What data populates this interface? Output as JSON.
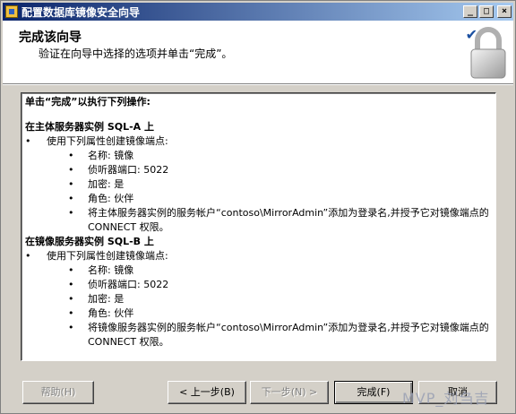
{
  "window": {
    "title": "配置数据库镜像安全向导"
  },
  "header": {
    "title": "完成该向导",
    "subtitle": "验证在向导中选择的选项并单击“完成”。"
  },
  "content": {
    "intro": "单击“完成”以执行下列操作:",
    "sections": [
      {
        "heading": "在主体服务器实例 SQL-A 上",
        "item": "使用下列属性创建镜像端点:",
        "props": [
          "名称: 镜像",
          "侦听器端口: 5022",
          "加密: 是",
          "角色: 伙伴",
          "将主体服务器实例的服务帐户“contoso\\MirrorAdmin”添加为登录名,并授予它对镜像端点的 CONNECT 权限。"
        ]
      },
      {
        "heading": "在镜像服务器实例 SQL-B 上",
        "item": "使用下列属性创建镜像端点:",
        "props": [
          "名称: 镜像",
          "侦听器端口: 5022",
          "加密: 是",
          "角色: 伙伴",
          "将镜像服务器实例的服务帐户“contoso\\MirrorAdmin”添加为登录名,并授予它对镜像端点的 CONNECT 权限。"
        ]
      }
    ]
  },
  "buttons": {
    "help": "帮助(H)",
    "back": "< 上一步(B)",
    "next": "下一步(N) >",
    "finish": "完成(F)",
    "cancel": "取消"
  },
  "watermark": "MVP_刘刍吉"
}
